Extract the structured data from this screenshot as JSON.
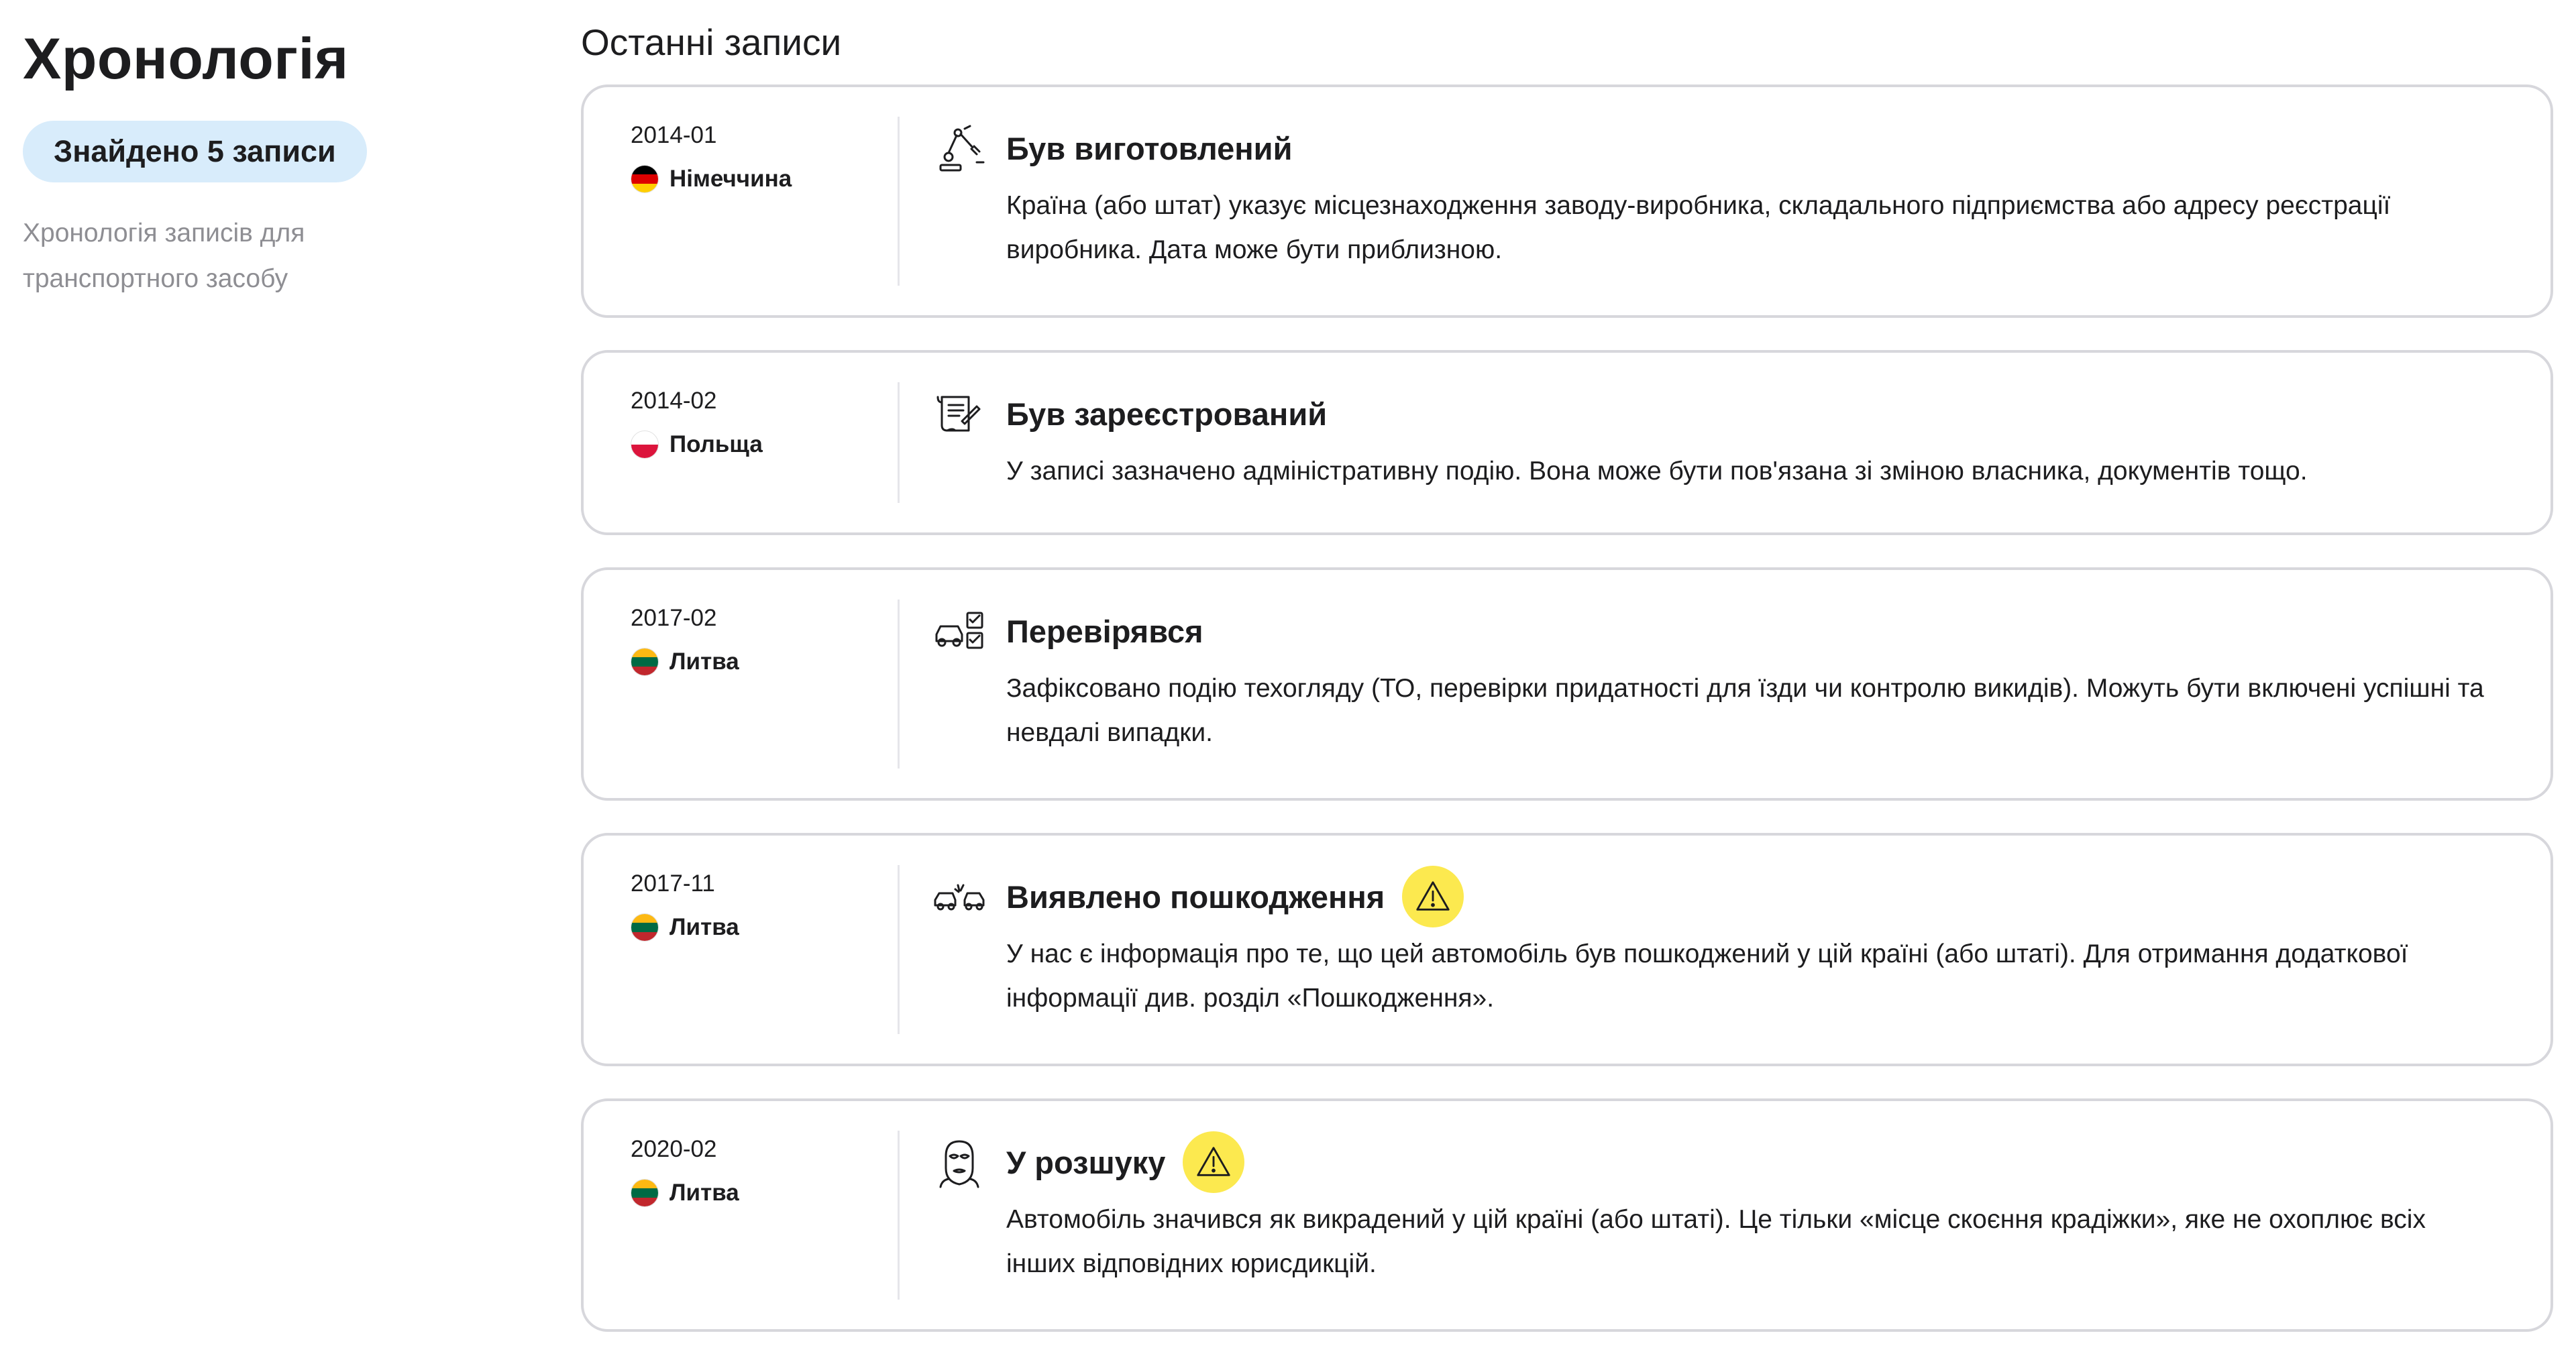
{
  "sidebar": {
    "title": "Хронологія",
    "badge": "Знайдено 5 записи",
    "description": "Хронологія записів для транспортного засобу"
  },
  "main": {
    "title": "Останні записи",
    "records": [
      {
        "date": "2014-01",
        "country": "Німеччина",
        "flag_colors": [
          "#000000",
          "#dd0000",
          "#ffce00"
        ],
        "icon": "robot-arm-icon",
        "title": "Був виготовлений",
        "warning": false,
        "text": "Країна (або штат) указує місцезнаходження заводу-виробника, складального підприємства або адресу реєстрації виробника. Дата може бути приблизною."
      },
      {
        "date": "2014-02",
        "country": "Польща",
        "flag_colors": [
          "#ffffff",
          "#dc143c"
        ],
        "icon": "document-icon",
        "title": "Був зареєстрований",
        "warning": false,
        "text": "У записі зазначено адміністративну подію. Вона може бути пов'язана зі зміною власника, документів тощо."
      },
      {
        "date": "2017-02",
        "country": "Литва",
        "flag_colors": [
          "#fdb913",
          "#006a44",
          "#c1272d"
        ],
        "icon": "car-inspection-icon",
        "title": "Перевірявся",
        "warning": false,
        "text": "Зафіксовано подію техогляду (ТО, перевірки придатності для їзди чи контролю викидів). Можуть бути включені успішні та невдалі випадки."
      },
      {
        "date": "2017-11",
        "country": "Литва",
        "flag_colors": [
          "#fdb913",
          "#006a44",
          "#c1272d"
        ],
        "icon": "car-crash-icon",
        "title": "Виявлено пошкодження",
        "warning": true,
        "text": "У нас є інформація про те, що цей автомобіль був пошкоджений у цій країні (або штаті). Для отримання додаткової інформації див. розділ «Пошкодження»."
      },
      {
        "date": "2020-02",
        "country": "Литва",
        "flag_colors": [
          "#fdb913",
          "#006a44",
          "#c1272d"
        ],
        "icon": "thief-mask-icon",
        "title": "У розшуку",
        "warning": true,
        "text": "Автомобіль значився як викрадений у цій країні (або штаті). Це тільки «місце скоєння крадіжки», яке не охоплює всіх інших відповідних юрисдикцій."
      }
    ]
  }
}
